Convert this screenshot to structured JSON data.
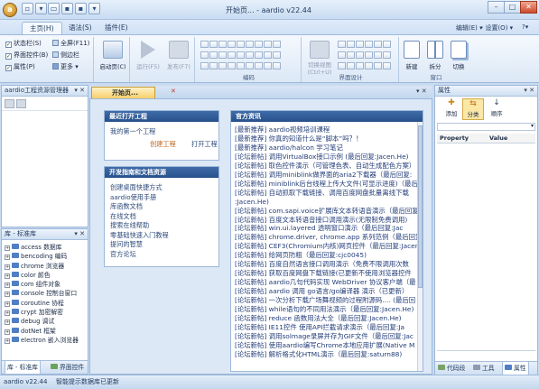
{
  "window": {
    "title": "开始页... - aardio v22.44",
    "controls": [
      "–",
      "□",
      "✕"
    ]
  },
  "ribbon_tabs": {
    "items": [
      "主页(H)",
      "语法(S)",
      "插件(E)"
    ],
    "right": [
      "编辑(E) ▾",
      "· 设置(O) ▾",
      "?▾"
    ]
  },
  "ribbon": {
    "view_checks": [
      {
        "label": "状态栏(S)",
        "checked": true
      },
      {
        "label": "界面控件(B)",
        "checked": true
      },
      {
        "label": "属性(P)",
        "checked": true
      }
    ],
    "view_more": [
      "全屏(F11)",
      "侧边栏",
      "更多 ▾"
    ],
    "buttons": {
      "compile": "启动页(C)",
      "run": "运行(F5)",
      "publish": "发布(F7)",
      "switch_view": "切换视图",
      "switch_view_key": "(Ctrl+U)",
      "new": "新建",
      "split": "拆分",
      "switch": "切换"
    },
    "groups": {
      "edit": "编码",
      "ui_design": "界面设计",
      "window": "窗口"
    }
  },
  "left_panel": {
    "project_title": "aardio工程资源管理器",
    "lib_title": "库 - 标准库",
    "lib_items": [
      "access 数据库",
      "bencoding 编码",
      "chrome 浏览器",
      "color 颜色",
      "com 组件对象",
      "console 控制台窗口",
      "coroutine 协程",
      "crypt 加密解密",
      "debug 调试",
      "dotNet 框架",
      "electron 嵌入浏览器"
    ],
    "bottom_tabs": [
      "库 - 标准库",
      "界面控件"
    ]
  },
  "document": {
    "tab_label": "开始页..."
  },
  "start_page": {
    "recent_title": "最近打开工程",
    "recent_items": [
      "我的第一个工程"
    ],
    "recent_actions": [
      "创建工程",
      "打开工程"
    ],
    "guide_title": "开发指南和文档资源",
    "guide_links": [
      "创建桌面快捷方式",
      "aardio使用手册",
      "库函数文档",
      "在线文档",
      "搜索在线帮助",
      "零基础快速入门教程",
      "提问的智慧",
      "官方论坛"
    ],
    "news_title": "官方资讯",
    "news": [
      "[最新推荐] aardio视频培训课程",
      "[最新推荐] 你真的知道什么是“脚本”吗？！",
      "[最新推荐] aardio/halcon 学习笔记",
      "[论坛新帖] 调用VirtualBox接口示例 (最后回复:Jacen.He)",
      "[论坛新帖] 取色控件演示（可管理色表、自动生成配色方案）",
      "[论坛新帖] 调用miniblink做界面的aria2下载器（最后回复:",
      "[论坛新帖] miniblink后台线程上传大文件(可显示进度)（最后",
      "[论坛新帖] 自动抓取下载链接、调用百度网盘批量离线下载",
      ":Jacen.He)",
      "[论坛新帖] com.sapi.voice扩展库文本转语音演示（最后回复",
      "[论坛新帖] 百度文本转语音接口调用演示(无限制免费调用)",
      "[论坛新帖] win.ui.layered 透明窗口演示（最后回复:Jac",
      "[论坛新帖] chrome.driver, chrome.app 系列范例（最后回复",
      "[论坛新帖] CEF3(Chromium内核)网页控件（最后回复:Jacen.He)",
      "[论坛新帖] 给网页防粗（最后回复:cjc0045)",
      "[论坛新帖] 百度自然语言接口调用演示（免费不限调用次数",
      "[论坛新帖] 获取百度网盘下载链接(已更新不使用浏览器控件",
      "[论坛新帖] aardio几句代码实现 WebDriver 协议客户端（最",
      "[论坛新帖] aardio 调用 go语言/go编译器 演示（已更新）",
      "[论坛新帖] 一次分析下载广场舞视频的过程附源码.... (最后回",
      "[论坛新帖] while语句的不同用法演示（最后回复:Jacen.He)",
      "[论坛新帖] reduce 函数用法大全（最后回复:Jacen.He)",
      "[论坛新帖] IE11控件 使用API拦截请求演示（最后回复:Ja",
      "[论坛新帖] 调用solmage录屏并存为GIF文件（最后回复:Jac",
      "[论坛新帖] 使用aardio编写Chrome本地应用扩展(Native M",
      "[论坛新帖] 解析格式化HTML演示（最后回复:saturn88)"
    ]
  },
  "properties": {
    "title": "属性",
    "toolbar": [
      "添加",
      "分类",
      "顺序"
    ],
    "columns": [
      "Property",
      "Value"
    ],
    "bottom_tabs": [
      "代码段",
      "工具",
      "属性"
    ]
  },
  "status_bar": {
    "version": "aardio v22.44",
    "message": "智能提示数据库已更新"
  }
}
